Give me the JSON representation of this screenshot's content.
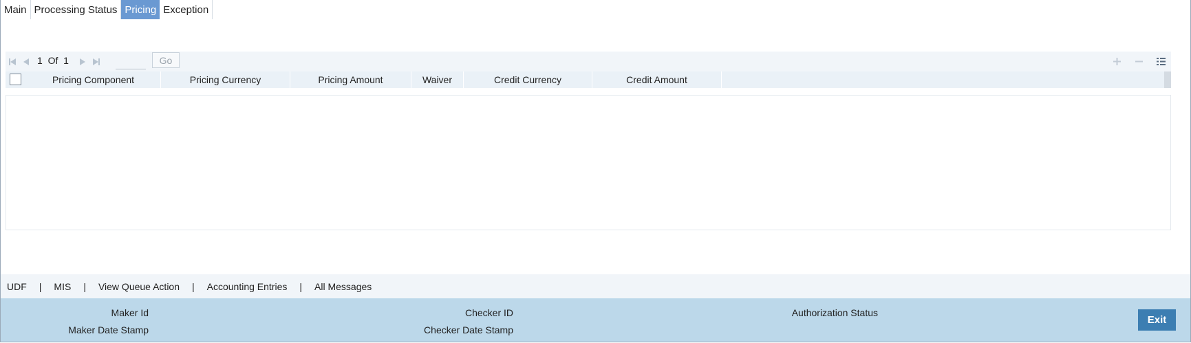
{
  "tabs": [
    {
      "label": "Main",
      "active": false
    },
    {
      "label": "Processing Status",
      "active": false
    },
    {
      "label": "Pricing",
      "active": true
    },
    {
      "label": "Exception",
      "active": false
    }
  ],
  "pager": {
    "current_page": "1",
    "of_label": "Of",
    "total_pages": "1",
    "page_input_value": "",
    "go_label": "Go"
  },
  "grid": {
    "columns": [
      "Pricing Component",
      "Pricing Currency",
      "Pricing Amount",
      "Waiver",
      "Credit Currency",
      "Credit Amount"
    ],
    "rows": []
  },
  "footer_links": [
    "UDF",
    "MIS",
    "View Queue Action",
    "Accounting Entries",
    "All Messages"
  ],
  "audit": {
    "maker_id_label": "Maker Id",
    "maker_date_label": "Maker Date Stamp",
    "checker_id_label": "Checker ID",
    "checker_date_label": "Checker Date Stamp",
    "authorization_status_label": "Authorization Status",
    "exit_label": "Exit"
  },
  "colors": {
    "active_tab": "#6a99d2",
    "audit_panel": "#bcd8ea",
    "exit_button": "#3c7eb2",
    "toolbar_bg": "#f1f5f9"
  },
  "icons": [
    "first-page-icon",
    "previous-page-icon",
    "next-page-icon",
    "last-page-icon",
    "add-row-icon",
    "delete-row-icon",
    "list-view-icon"
  ]
}
